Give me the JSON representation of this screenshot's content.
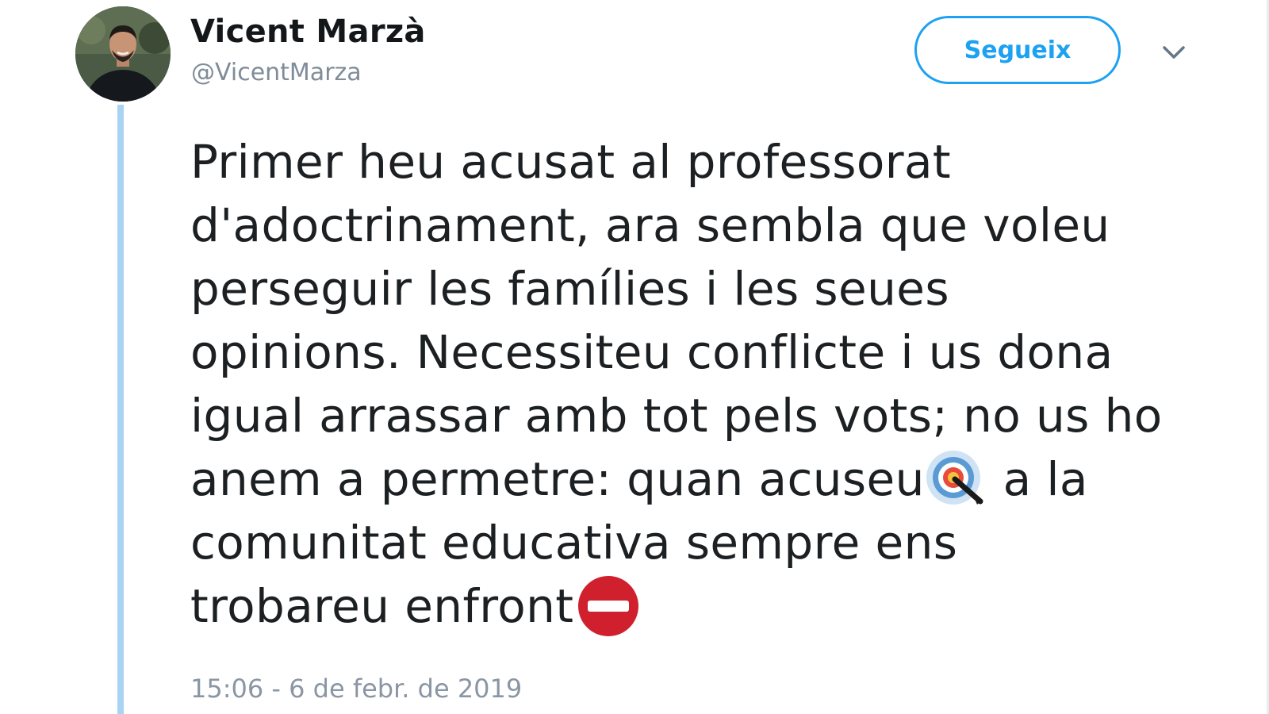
{
  "author": {
    "name": "Vicent Marzà",
    "handle": "@VicentMarza"
  },
  "follow_button": {
    "label": "Segueix"
  },
  "tweet": {
    "lines": [
      "Primer heu acusat al professorat",
      "d'adoctrinament, ara sembla que voleu",
      "perseguir les famílies i les seues",
      "opinions. Necessiteu conflicte i us dona",
      "igual arrassar amb tot pels vots; no us ho"
    ],
    "line6_before_emoji": "anem a permetre: quan acuseu",
    "line6_after_emoji": " a la",
    "line7": "comunitat educativa sempre ens",
    "line8": "trobareu enfront",
    "emojis": [
      "direct-hit-icon",
      "no-entry-icon"
    ]
  },
  "timestamp": "15:06 - 6 de febr. de 2019",
  "colors": {
    "accent": "#1da1f2",
    "thread_line": "#a8d3f3",
    "text": "#1c2022",
    "muted": "#7f8c99",
    "no_entry": "#d0202e"
  }
}
